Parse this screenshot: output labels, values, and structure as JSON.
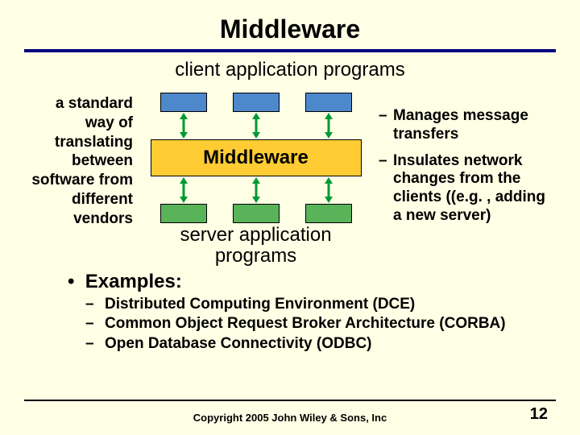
{
  "title": "Middleware",
  "subtitle": "client application programs",
  "left_text": "a standard way of translating between software from different vendors",
  "middleware_label": "Middleware",
  "server_label": "server application programs",
  "right_bullets": [
    "Manages message transfers",
    "Insulates network changes from the clients ((e.g. , adding a new server)"
  ],
  "examples_label": "Examples:",
  "examples": [
    "Distributed Computing Environment (DCE)",
    "Common Object Request Broker Architecture (CORBA)",
    "Open Database Connectivity (ODBC)"
  ],
  "copyright": "Copyright 2005 John Wiley & Sons, Inc",
  "page_number": "12"
}
